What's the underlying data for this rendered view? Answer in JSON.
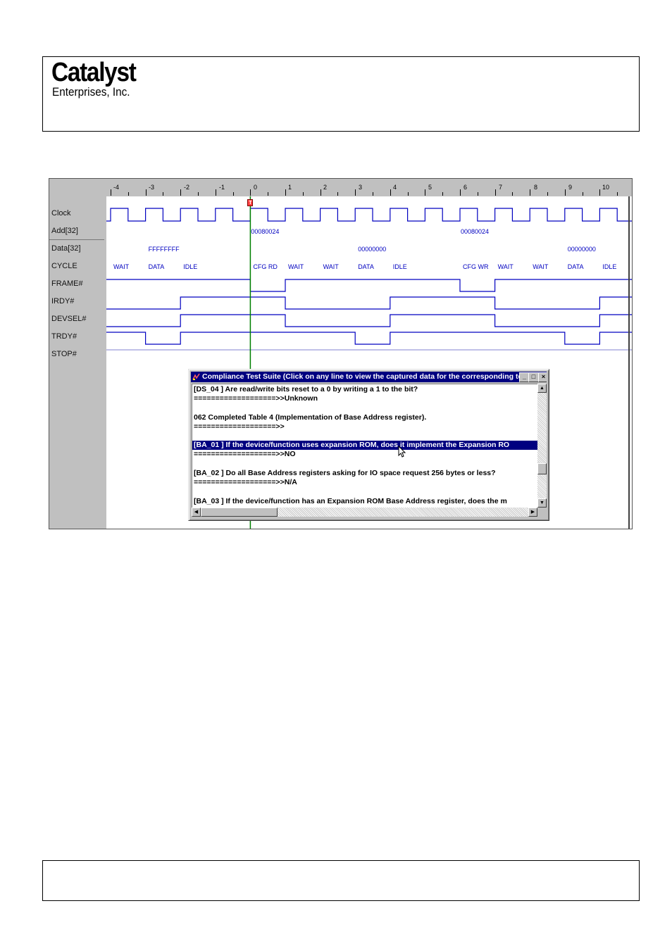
{
  "header": {
    "logo_main": "Catalyst",
    "logo_sub": "Enterprises, Inc."
  },
  "analyzer": {
    "ruler_ticks": [
      "-4",
      "-3",
      "-2",
      "-1",
      "0",
      "1",
      "2",
      "3",
      "4",
      "5",
      "6",
      "7",
      "8",
      "9",
      "10"
    ],
    "trigger_marker": "T",
    "signals": [
      "Clock",
      "Add[32]",
      "Data[32]",
      "CYCLE",
      "FRAME#",
      "IRDY#",
      "DEVSEL#",
      "TRDY#",
      "STOP#"
    ],
    "add_values": [
      "00080024",
      "00080024"
    ],
    "data_values": [
      "FFFFFFFF",
      "00000000",
      "00000000"
    ],
    "cycle_labels": [
      "WAIT",
      "DATA",
      "IDLE",
      "CFG RD",
      "WAIT",
      "WAIT",
      "DATA",
      "IDLE",
      "CFG WR",
      "WAIT",
      "WAIT",
      "DATA",
      "IDLE"
    ],
    "colors": {
      "wave": "#0000c0",
      "trigger_line": "#008000",
      "panel": "#c0c0c0"
    }
  },
  "dialog": {
    "title": "Compliance Test Suite (Click on any line to view the captured data for the corresponding test)",
    "min_label": "_",
    "max_label": "□",
    "close_label": "×",
    "lines": [
      "[DS_04   ] Are read/write bits reset to a 0 by writing a 1 to the bit?",
      "===================>>Unknown",
      "",
      "062     Completed Table 4 (Implementation of Base Address register).",
      "===================>>",
      "",
      "[BA_01   ] If the device/function uses expansion ROM, does it implement the Expansion RO",
      "===================>>NO",
      "",
      "[BA_02   ] Do all Base Address registers asking for IO space request 256 bytes or less?",
      "===================>>N/A",
      "",
      "[BA_03   ] If the device/function has an Expansion ROM Base Address register, does the m"
    ],
    "selected_line_index": 6,
    "colors": {
      "titlebar": "#000080",
      "selection": "#000080"
    }
  }
}
